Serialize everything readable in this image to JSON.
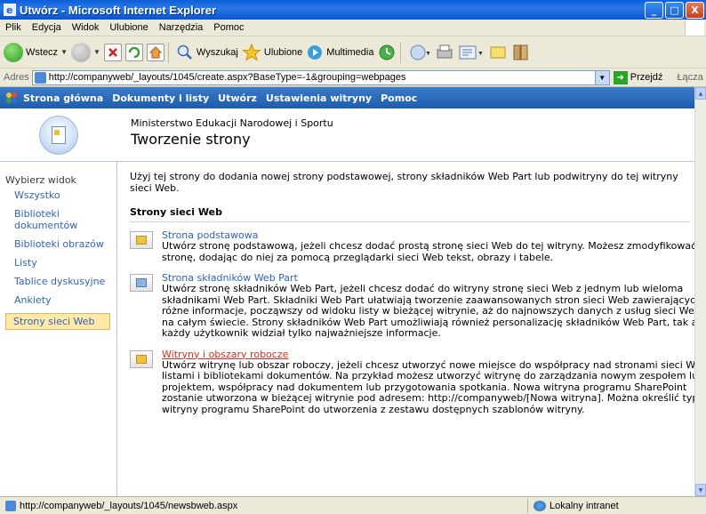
{
  "window": {
    "title": "Utwórz - Microsoft Internet Explorer",
    "min_label": "_",
    "max_label": "□",
    "close_label": "X"
  },
  "menu": [
    "Plik",
    "Edycja",
    "Widok",
    "Ulubione",
    "Narzędzia",
    "Pomoc"
  ],
  "toolbar": {
    "back_label": "Wstecz",
    "search_label": "Wyszukaj",
    "favorites_label": "Ulubione",
    "media_label": "Multimedia"
  },
  "address": {
    "label": "Adres",
    "url": "http://companyweb/_layouts/1045/create.aspx?BaseType=-1&grouping=webpages",
    "go_label": "Przejdź",
    "links_label": "Łącza"
  },
  "spnav": [
    "Strona główna",
    "Dokumenty i listy",
    "Utwórz",
    "Ustawienia witryny",
    "Pomoc"
  ],
  "header": {
    "site_name": "Ministerstwo Edukacji Narodowej i Sportu",
    "page_title": "Tworzenie strony"
  },
  "leftnav": {
    "heading": "Wybierz widok",
    "items": [
      {
        "label": "Wszystko"
      },
      {
        "label": "Biblioteki dokumentów"
      },
      {
        "label": "Biblioteki obrazów"
      },
      {
        "label": "Listy"
      },
      {
        "label": "Tablice dyskusyjne"
      },
      {
        "label": "Ankiety"
      },
      {
        "label": "Strony sieci Web"
      }
    ]
  },
  "content": {
    "intro": "Użyj tej strony do dodania nowej strony podstawowej, strony składników Web Part lub podwitryny do tej witryny sieci Web.",
    "section_heading": "Strony sieci Web",
    "items": [
      {
        "title": "Strona podstawowa",
        "description": "Utwórz stronę podstawową, jeżeli chcesz dodać prostą stronę sieci Web do tej witryny. Możesz zmodyfikować stronę, dodając do niej za pomocą przeglądarki sieci Web tekst, obrazy i tabele."
      },
      {
        "title": "Strona składników Web Part",
        "description": "Utwórz stronę składników Web Part, jeżeli chcesz dodać do witryny stronę sieci Web z jednym lub wieloma składnikami Web Part. Składniki Web Part ułatwiają tworzenie zaawansowanych stron sieci Web zawierających różne informacje, począwszy od widoku listy w bieżącej witrynie, aż do najnowszych danych z usług sieci Web na całym świecie. Strony składników Web Part umożliwiają również personalizację składników Web Part, tak aby każdy użytkownik widział tylko najważniejsze informacje."
      },
      {
        "title": "Witryny i obszary robocze",
        "description": "Utwórz witrynę lub obszar roboczy, jeżeli chcesz utworzyć nowe miejsce do współpracy nad stronami sieci Web, listami i bibliotekami dokumentów. Na przykład możesz utworzyć witrynę do zarządzania nowym zespołem lub projektem, współpracy nad dokumentem lub przygotowania spotkania. Nowa witryna programu SharePoint zostanie utworzona w bieżącej witrynie pod adresem: http://companyweb/[Nowa witryna]. Można określić typ witryny programu SharePoint do utworzenia z zestawu dostępnych szablonów witryny."
      }
    ]
  },
  "status": {
    "url": "http://companyweb/_layouts/1045/newsbweb.aspx",
    "zone": "Lokalny intranet"
  }
}
